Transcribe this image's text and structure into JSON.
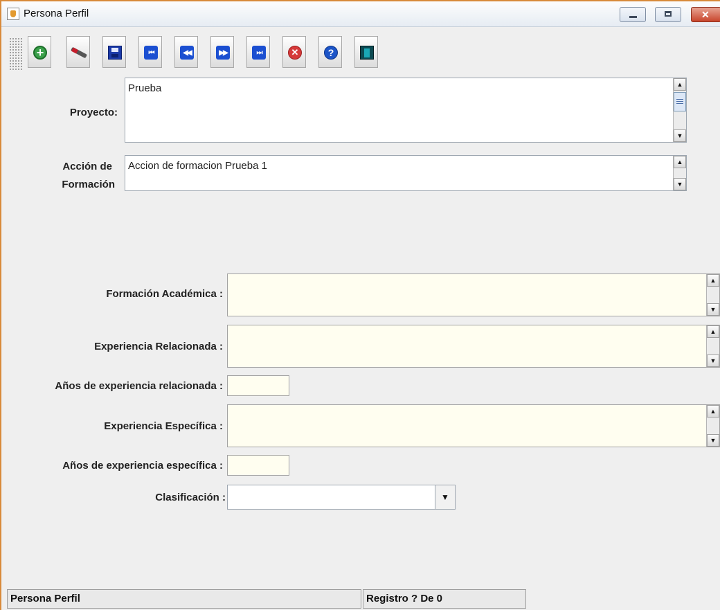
{
  "window": {
    "title": "Persona Perfil"
  },
  "toolbar": {
    "buttons": [
      {
        "name": "add-icon",
        "glyph": "+"
      },
      {
        "name": "edit-icon",
        "glyph": ""
      },
      {
        "name": "save-icon",
        "glyph": ""
      },
      {
        "name": "first-record-icon",
        "glyph": "⏮"
      },
      {
        "name": "previous-record-icon",
        "glyph": "◀◀"
      },
      {
        "name": "next-record-icon",
        "glyph": "▶▶"
      },
      {
        "name": "last-record-icon",
        "glyph": "⏭"
      },
      {
        "name": "cancel-icon",
        "glyph": "✕"
      },
      {
        "name": "help-icon",
        "glyph": "?"
      },
      {
        "name": "exit-door-icon",
        "glyph": ""
      }
    ]
  },
  "form": {
    "proyecto": {
      "label": "Proyecto:",
      "value": "Prueba"
    },
    "accion": {
      "label_line1": "Acción de",
      "label_line2": "Formación",
      "value": "Accion de formacion Prueba 1"
    },
    "formacion_academica": {
      "label": "Formación Académica :",
      "value": ""
    },
    "experiencia_relacionada": {
      "label": "Experiencia Relacionada :",
      "value": ""
    },
    "anios_relacionada": {
      "label": "Años de experiencia relacionada :",
      "value": ""
    },
    "experiencia_especifica": {
      "label": "Experiencia Específica :",
      "value": ""
    },
    "anios_especifica": {
      "label": "Años de experiencia específica :",
      "value": ""
    },
    "clasificacion": {
      "label": "Clasificación :",
      "value": ""
    }
  },
  "status": {
    "left": "Persona Perfil",
    "right": "Registro ? De 0"
  },
  "colors": {
    "accent_border": "#d88a3a",
    "field_yellow": "#fffef0",
    "window_bg": "#efefef"
  }
}
